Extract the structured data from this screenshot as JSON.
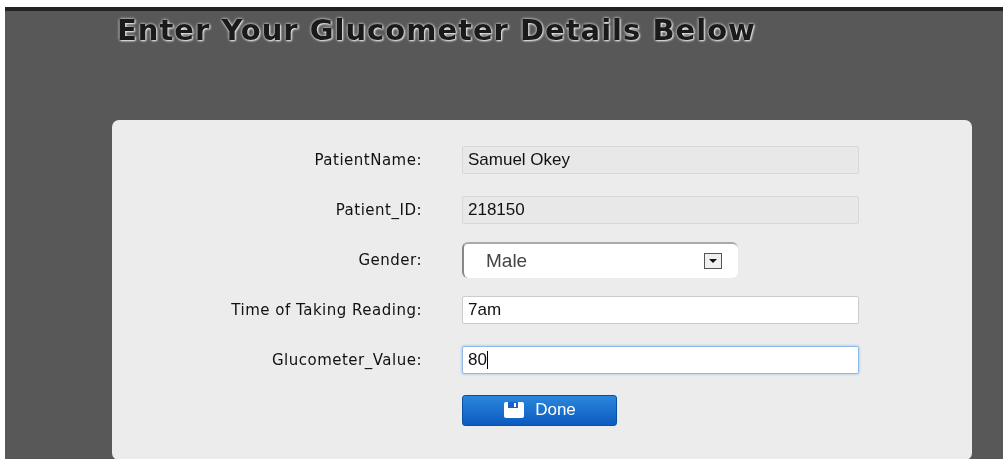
{
  "title": "Enter Your Glucometer Details Below",
  "fields": [
    {
      "label": "PatientName:",
      "kind": "readonly",
      "value": "Samuel Okey"
    },
    {
      "label": "Patient_ID:",
      "kind": "readonly",
      "value": "218150"
    },
    {
      "label": "Gender:",
      "kind": "select",
      "value": "Male"
    },
    {
      "label": "Time of Taking Reading:",
      "kind": "text",
      "value": "7am",
      "focused": false
    },
    {
      "label": "Glucometer_Value:",
      "kind": "text",
      "value": "80",
      "focused": true
    }
  ],
  "button": {
    "label": "Done"
  }
}
